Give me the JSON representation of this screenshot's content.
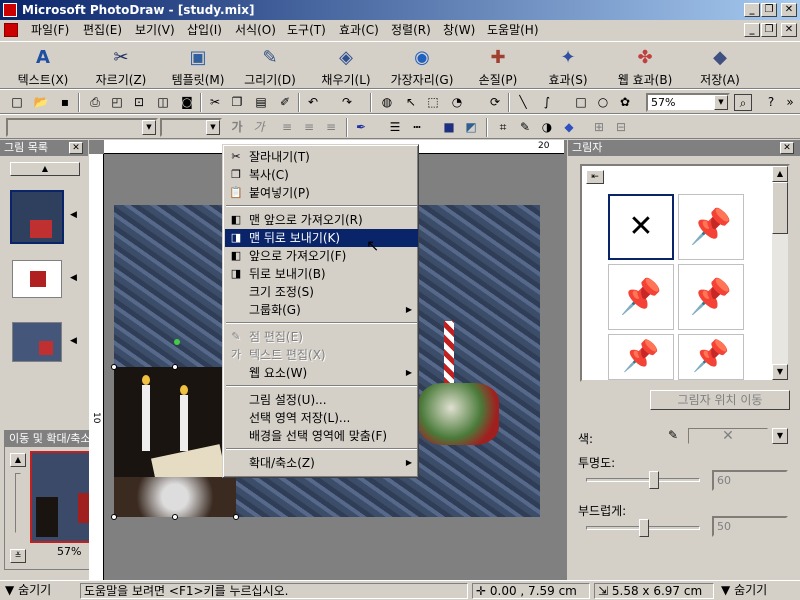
{
  "window": {
    "title": "Microsoft PhotoDraw - [study.mix]",
    "min": "_",
    "max": "❐",
    "close": "✕",
    "doc_min": "_",
    "doc_max": "❐",
    "doc_close": "✕"
  },
  "menu": [
    "파일(F)",
    "편집(E)",
    "보기(V)",
    "삽입(I)",
    "서식(O)",
    "도구(T)",
    "효과(C)",
    "정렬(R)",
    "창(W)",
    "도움말(H)"
  ],
  "big_toolbar": [
    "텍스트(X)",
    "자르기(Z)",
    "템플릿(M)",
    "그리기(D)",
    "채우기(L)",
    "가장자리(G)",
    "손질(P)",
    "효과(S)",
    "웹 효과(B)",
    "저장(A)"
  ],
  "standard_toolbar": {
    "zoom_value": "57%"
  },
  "format_toolbar": {
    "font_name": "",
    "font_size": "",
    "bold": "가",
    "italic": "가"
  },
  "picture_list": {
    "title": "그림 목록",
    "close": "✕",
    "scroll_up": "▲"
  },
  "pan_zoom": {
    "title": "이동 및 확대/축소",
    "close": "✕",
    "zoom_value": "57%"
  },
  "ruler": {
    "h_label": "20",
    "v_label": "10"
  },
  "context_menu": {
    "items": [
      {
        "label": "잘라내기(T)",
        "icon": "cut-icon",
        "glyph": "✂",
        "state": "normal"
      },
      {
        "label": "복사(C)",
        "icon": "copy-icon",
        "glyph": "❐",
        "state": "normal"
      },
      {
        "label": "붙여넣기(P)",
        "icon": "paste-icon",
        "glyph": "📋",
        "state": "normal"
      },
      {
        "label": "맨 앞으로 가져오기(R)",
        "icon": "bring-to-front-icon",
        "glyph": "◧",
        "state": "normal"
      },
      {
        "label": "맨 뒤로 보내기(K)",
        "icon": "send-to-back-icon",
        "glyph": "◨",
        "state": "highlighted"
      },
      {
        "label": "앞으로 가져오기(F)",
        "icon": "bring-forward-icon",
        "glyph": "◧",
        "state": "normal"
      },
      {
        "label": "뒤로 보내기(B)",
        "icon": "send-backward-icon",
        "glyph": "◨",
        "state": "normal"
      },
      {
        "label": "크기 조정(S)",
        "icon": "",
        "glyph": "",
        "state": "normal"
      },
      {
        "label": "그룹화(G)",
        "icon": "",
        "glyph": "",
        "state": "normal",
        "submenu": true
      },
      {
        "label": "점 편집(E)",
        "icon": "edit-points-icon",
        "glyph": "✎",
        "state": "disabled"
      },
      {
        "label": "텍스트 편집(X)",
        "icon": "edit-text-icon",
        "glyph": "가",
        "state": "disabled"
      },
      {
        "label": "웹 요소(W)",
        "icon": "",
        "glyph": "",
        "state": "normal",
        "submenu": true
      },
      {
        "label": "그림 설정(U)...",
        "icon": "",
        "glyph": "",
        "state": "normal"
      },
      {
        "label": "선택 영역 저장(L)...",
        "icon": "",
        "glyph": "",
        "state": "normal"
      },
      {
        "label": "배경을 선택 영역에 맞춤(F)",
        "icon": "",
        "glyph": "",
        "state": "normal"
      },
      {
        "label": "확대/축소(Z)",
        "icon": "",
        "glyph": "",
        "state": "normal",
        "submenu": true
      }
    ]
  },
  "shadow_panel": {
    "title": "그림자",
    "close": "✕",
    "position_button": "그림자 위치 이동",
    "color_label": "색:",
    "transparency_label": "투명도:",
    "transparency_value": "60",
    "transparency_fraction": 0.6,
    "softness_label": "부드럽게:",
    "softness_value": "50",
    "softness_fraction": 0.5
  },
  "status": {
    "hide_left": "숨기기",
    "help_text": "도움말을 보려면 <F1>키를 누르십시오.",
    "position": "0.00 , 7.59  cm",
    "size": "5.58 x 6.97  cm",
    "hide_right": "숨기기"
  }
}
